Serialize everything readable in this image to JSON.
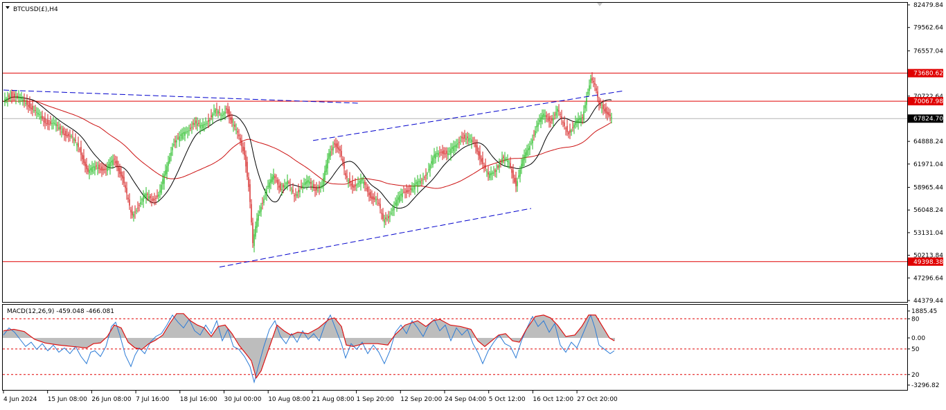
{
  "window": {
    "symbol_title": "BTCUSD(£),H4",
    "indicator_title": "MACD(12,26,9) -459.048 -466.081"
  },
  "colors": {
    "bull": "#22bb22",
    "bear": "#d42020",
    "sma_black": "#000000",
    "ma_red": "#cc1111",
    "trend_blue": "#0000cc",
    "hline_red": "#e00000",
    "price_line": "#b4b4b4",
    "macd_hist": "#bdbdbd",
    "macd_line": "#2b7bd6",
    "signal_line": "#dd1111"
  },
  "chart_data": [
    {
      "type": "candlestick",
      "title": "BTCUSD(£),H4",
      "ylim": [
        44379.44,
        82479.84
      ],
      "y_ticks": [
        {
          "value": 82479.84,
          "label": "82479.84"
        },
        {
          "value": 79562.64,
          "label": "79562.64"
        },
        {
          "value": 76557.04,
          "label": "76557.04"
        },
        {
          "value": 70722.64,
          "label": "70722.64"
        },
        {
          "value": 64888.24,
          "label": "64888.24"
        },
        {
          "value": 61971.04,
          "label": "61971.04"
        },
        {
          "value": 58965.44,
          "label": "58965.44"
        },
        {
          "value": 56048.24,
          "label": "56048.24"
        },
        {
          "value": 53131.04,
          "label": "53131.04"
        },
        {
          "value": 50213.84,
          "label": "50213.84"
        },
        {
          "value": 47296.64,
          "label": "47296.64"
        },
        {
          "value": 44379.44,
          "label": "44379.44"
        }
      ],
      "x_labels": [
        "4 Jun 2024",
        "15 Jun 08:00",
        "26 Jun 08:00",
        "7 Jul 16:00",
        "18 Jul 16:00",
        "30 Jul 00:00",
        "10 Aug 08:00",
        "21 Aug 08:00",
        "1 Sep 20:00",
        "12 Sep 20:00",
        "24 Sep 04:00",
        "5 Oct 12:00",
        "16 Oct 12:00",
        "27 Oct 20:00"
      ],
      "close_path": [
        [
          0,
          70000
        ],
        [
          10,
          71000
        ],
        [
          22,
          70400
        ],
        [
          35,
          69800
        ],
        [
          48,
          68400
        ],
        [
          60,
          67500
        ],
        [
          72,
          67100
        ],
        [
          85,
          66200
        ],
        [
          98,
          65400
        ],
        [
          110,
          63900
        ],
        [
          122,
          60900
        ],
        [
          135,
          61700
        ],
        [
          148,
          61200
        ],
        [
          160,
          62600
        ],
        [
          172,
          60200
        ],
        [
          185,
          55200
        ],
        [
          195,
          56800
        ],
        [
          205,
          57900
        ],
        [
          215,
          57400
        ],
        [
          225,
          58200
        ],
        [
          235,
          61200
        ],
        [
          245,
          64800
        ],
        [
          255,
          65400
        ],
        [
          265,
          66200
        ],
        [
          275,
          67400
        ],
        [
          285,
          66600
        ],
        [
          295,
          67600
        ],
        [
          305,
          68900
        ],
        [
          315,
          68100
        ],
        [
          322,
          69300
        ],
        [
          330,
          67200
        ],
        [
          340,
          65400
        ],
        [
          348,
          63400
        ],
        [
          355,
          58400
        ],
        [
          360,
          51500
        ],
        [
          366,
          54800
        ],
        [
          372,
          56700
        ],
        [
          380,
          58800
        ],
        [
          390,
          60300
        ],
        [
          400,
          58900
        ],
        [
          410,
          59600
        ],
        [
          420,
          57800
        ],
        [
          430,
          59200
        ],
        [
          440,
          59600
        ],
        [
          450,
          58800
        ],
        [
          460,
          59200
        ],
        [
          470,
          63200
        ],
        [
          478,
          64800
        ],
        [
          486,
          63600
        ],
        [
          494,
          60200
        ],
        [
          505,
          59200
        ],
        [
          518,
          59700
        ],
        [
          530,
          57900
        ],
        [
          540,
          57200
        ],
        [
          548,
          54700
        ],
        [
          556,
          55300
        ],
        [
          566,
          56800
        ],
        [
          578,
          58500
        ],
        [
          590,
          58800
        ],
        [
          602,
          59800
        ],
        [
          612,
          61000
        ],
        [
          622,
          62900
        ],
        [
          632,
          63700
        ],
        [
          642,
          63300
        ],
        [
          652,
          64200
        ],
        [
          662,
          65600
        ],
        [
          672,
          65000
        ],
        [
          680,
          64700
        ],
        [
          690,
          62500
        ],
        [
          700,
          60300
        ],
        [
          710,
          61200
        ],
        [
          720,
          62700
        ],
        [
          730,
          62000
        ],
        [
          740,
          59400
        ],
        [
          750,
          62400
        ],
        [
          760,
          64400
        ],
        [
          770,
          67000
        ],
        [
          780,
          68200
        ],
        [
          790,
          67600
        ],
        [
          800,
          68900
        ],
        [
          808,
          67100
        ],
        [
          816,
          66100
        ],
        [
          826,
          67200
        ],
        [
          836,
          67900
        ],
        [
          842,
          70800
        ],
        [
          848,
          73100
        ],
        [
          854,
          71900
        ],
        [
          860,
          69500
        ],
        [
          866,
          69300
        ],
        [
          872,
          68600
        ],
        [
          878,
          67824.7
        ]
      ],
      "horizontal_levels": [
        {
          "value": 73680.62,
          "label": "73680.62"
        },
        {
          "value": 70067.98,
          "label": "70067.98"
        },
        {
          "value": 49398.38,
          "label": "49398.38"
        }
      ],
      "current_price": {
        "value": 67824.7,
        "label": "67824.70"
      },
      "trend_lines": [
        {
          "from": [
            0,
            71500
          ],
          "to": [
            515,
            69800
          ]
        },
        {
          "from": [
            447,
            65000
          ],
          "to": [
            895,
            71400
          ]
        },
        {
          "from": [
            312,
            48700
          ],
          "to": [
            762,
            56250
          ]
        }
      ]
    },
    {
      "type": "line",
      "title": "MACD(12,26,9) -459.048 -466.081",
      "ylim": [
        -3296.82,
        1885.45
      ],
      "y_ticks": [
        {
          "value": 1885.45,
          "label": "1885.45"
        },
        {
          "value": 1340,
          "label": "80"
        },
        {
          "value": 0,
          "label": "0.00"
        },
        {
          "value": -770,
          "label": "50"
        },
        {
          "value": -2560,
          "label": "20"
        },
        {
          "value": -3296.82,
          "label": "-3296.82"
        }
      ],
      "dashed_levels": [
        1340,
        -770,
        -2560
      ],
      "signal_path": [
        [
          0,
          500
        ],
        [
          15,
          600
        ],
        [
          30,
          450
        ],
        [
          45,
          -100
        ],
        [
          60,
          -350
        ],
        [
          80,
          -500
        ],
        [
          100,
          -600
        ],
        [
          120,
          -700
        ],
        [
          130,
          -400
        ],
        [
          140,
          -350
        ],
        [
          150,
          100
        ],
        [
          160,
          900
        ],
        [
          170,
          700
        ],
        [
          180,
          -300
        ],
        [
          190,
          -700
        ],
        [
          200,
          -800
        ],
        [
          210,
          -400
        ],
        [
          220,
          -150
        ],
        [
          230,
          200
        ],
        [
          240,
          1000
        ],
        [
          250,
          1700
        ],
        [
          260,
          1700
        ],
        [
          270,
          1200
        ],
        [
          280,
          900
        ],
        [
          290,
          700
        ],
        [
          300,
          100
        ],
        [
          310,
          800
        ],
        [
          320,
          900
        ],
        [
          330,
          300
        ],
        [
          340,
          -500
        ],
        [
          350,
          -1100
        ],
        [
          358,
          -1600
        ],
        [
          365,
          -2800
        ],
        [
          372,
          -2300
        ],
        [
          385,
          -500
        ],
        [
          395,
          900
        ],
        [
          405,
          500
        ],
        [
          415,
          200
        ],
        [
          425,
          400
        ],
        [
          440,
          300
        ],
        [
          455,
          700
        ],
        [
          470,
          1300
        ],
        [
          478,
          1400
        ],
        [
          488,
          800
        ],
        [
          495,
          -500
        ],
        [
          505,
          -600
        ],
        [
          520,
          -400
        ],
        [
          540,
          -400
        ],
        [
          555,
          -500
        ],
        [
          565,
          200
        ],
        [
          580,
          900
        ],
        [
          598,
          1200
        ],
        [
          610,
          800
        ],
        [
          620,
          1200
        ],
        [
          630,
          1300
        ],
        [
          645,
          900
        ],
        [
          660,
          800
        ],
        [
          675,
          600
        ],
        [
          685,
          -200
        ],
        [
          695,
          -600
        ],
        [
          705,
          -200
        ],
        [
          715,
          200
        ],
        [
          725,
          300
        ],
        [
          735,
          -200
        ],
        [
          745,
          -300
        ],
        [
          755,
          600
        ],
        [
          768,
          1500
        ],
        [
          780,
          1600
        ],
        [
          790,
          1400
        ],
        [
          800,
          900
        ],
        [
          812,
          100
        ],
        [
          825,
          200
        ],
        [
          835,
          800
        ],
        [
          845,
          1600
        ],
        [
          855,
          1600
        ],
        [
          865,
          800
        ],
        [
          875,
          0
        ],
        [
          882,
          -200
        ]
      ],
      "macd_path": [
        [
          0,
          200
        ],
        [
          8,
          700
        ],
        [
          16,
          400
        ],
        [
          24,
          -100
        ],
        [
          32,
          -600
        ],
        [
          40,
          -300
        ],
        [
          48,
          -800
        ],
        [
          56,
          -400
        ],
        [
          64,
          -900
        ],
        [
          72,
          -500
        ],
        [
          80,
          -1000
        ],
        [
          88,
          -700
        ],
        [
          96,
          -1100
        ],
        [
          104,
          -600
        ],
        [
          112,
          -1300
        ],
        [
          120,
          -1800
        ],
        [
          126,
          -1000
        ],
        [
          132,
          -900
        ],
        [
          140,
          -1300
        ],
        [
          148,
          -600
        ],
        [
          156,
          800
        ],
        [
          162,
          1100
        ],
        [
          168,
          200
        ],
        [
          176,
          -1200
        ],
        [
          184,
          -2000
        ],
        [
          190,
          -1200
        ],
        [
          196,
          -700
        ],
        [
          204,
          -1100
        ],
        [
          212,
          -300
        ],
        [
          220,
          100
        ],
        [
          228,
          300
        ],
        [
          236,
          900
        ],
        [
          244,
          1600
        ],
        [
          252,
          1100
        ],
        [
          260,
          700
        ],
        [
          268,
          1300
        ],
        [
          276,
          500
        ],
        [
          284,
          200
        ],
        [
          292,
          900
        ],
        [
          300,
          300
        ],
        [
          308,
          1200
        ],
        [
          316,
          -200
        ],
        [
          324,
          600
        ],
        [
          332,
          -600
        ],
        [
          340,
          -800
        ],
        [
          348,
          -1300
        ],
        [
          356,
          -2000
        ],
        [
          362,
          -3100
        ],
        [
          368,
          -2000
        ],
        [
          376,
          -600
        ],
        [
          384,
          600
        ],
        [
          392,
          1200
        ],
        [
          400,
          100
        ],
        [
          408,
          -400
        ],
        [
          416,
          300
        ],
        [
          424,
          -300
        ],
        [
          432,
          500
        ],
        [
          440,
          -100
        ],
        [
          448,
          300
        ],
        [
          456,
          -200
        ],
        [
          464,
          900
        ],
        [
          472,
          1600
        ],
        [
          480,
          600
        ],
        [
          488,
          -400
        ],
        [
          494,
          -1400
        ],
        [
          502,
          -400
        ],
        [
          510,
          -800
        ],
        [
          518,
          -300
        ],
        [
          526,
          -1100
        ],
        [
          534,
          -500
        ],
        [
          542,
          -1000
        ],
        [
          550,
          -1800
        ],
        [
          558,
          -900
        ],
        [
          566,
          400
        ],
        [
          574,
          900
        ],
        [
          582,
          300
        ],
        [
          590,
          1200
        ],
        [
          598,
          700
        ],
        [
          606,
          100
        ],
        [
          614,
          900
        ],
        [
          622,
          1300
        ],
        [
          630,
          500
        ],
        [
          638,
          900
        ],
        [
          646,
          -200
        ],
        [
          654,
          700
        ],
        [
          662,
          200
        ],
        [
          670,
          600
        ],
        [
          678,
          -400
        ],
        [
          686,
          -1100
        ],
        [
          692,
          -1800
        ],
        [
          700,
          -900
        ],
        [
          708,
          -300
        ],
        [
          716,
          200
        ],
        [
          724,
          -400
        ],
        [
          732,
          -600
        ],
        [
          740,
          -1400
        ],
        [
          748,
          -200
        ],
        [
          756,
          700
        ],
        [
          764,
          1500
        ],
        [
          772,
          800
        ],
        [
          780,
          1200
        ],
        [
          788,
          400
        ],
        [
          796,
          1000
        ],
        [
          804,
          -500
        ],
        [
          812,
          -1000
        ],
        [
          820,
          -300
        ],
        [
          828,
          -700
        ],
        [
          836,
          200
        ],
        [
          842,
          900
        ],
        [
          848,
          1600
        ],
        [
          854,
          700
        ],
        [
          860,
          -500
        ],
        [
          868,
          -800
        ],
        [
          876,
          -1100
        ],
        [
          882,
          -900
        ]
      ]
    }
  ]
}
